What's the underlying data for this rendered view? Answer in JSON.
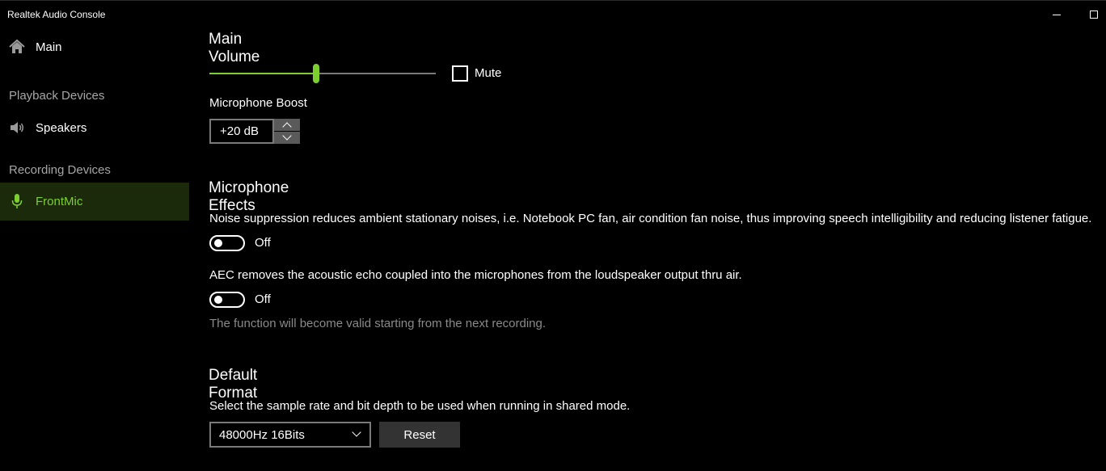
{
  "app": {
    "title": "Realtek Audio Console"
  },
  "sidebar": {
    "main": {
      "label": "Main",
      "icon": "home-icon"
    },
    "playback_header": "Playback Devices",
    "speakers": {
      "label": "Speakers",
      "icon": "speaker-icon"
    },
    "recording_header": "Recording Devices",
    "frontmic": {
      "label": "FrontMic",
      "icon": "microphone-icon",
      "selected": true
    }
  },
  "main_volume": {
    "heading": "Main Volume",
    "level_fraction": 0.47,
    "mute_label": "Mute",
    "muted": false
  },
  "mic_boost": {
    "label": "Microphone Boost",
    "value": "+20 dB"
  },
  "effects": {
    "heading": "Microphone Effects",
    "noise_suppression": {
      "description": "Noise suppression reduces ambient stationary noises, i.e. Notebook PC fan, air condition fan noise, thus improving speech intelligibility and reducing listener fatigue.",
      "state": "Off"
    },
    "aec": {
      "description": "AEC removes the acoustic echo coupled into the microphones from the loudspeaker output thru air.",
      "state": "Off"
    },
    "note": "The function will become valid starting from the next recording."
  },
  "default_format": {
    "heading": "Default Format",
    "description": "Select the sample rate and bit depth to be used when running in shared mode.",
    "selected": "48000Hz 16Bits",
    "reset_label": "Reset"
  },
  "colors": {
    "accent": "#7ccf2f",
    "selected_bg": "#1b2a0b",
    "background": "#000000",
    "muted_text": "#a6a6a6"
  }
}
